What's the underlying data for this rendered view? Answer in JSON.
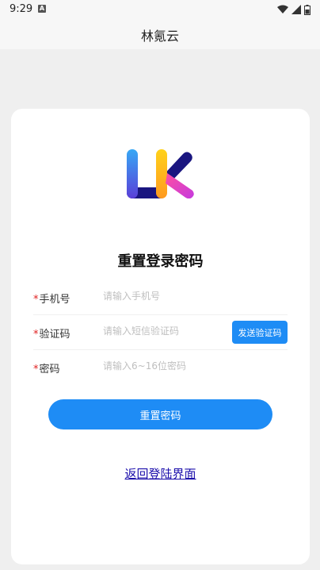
{
  "status_bar": {
    "time": "9:29",
    "notification_icon": "a-icon",
    "wifi_icon": "wifi-icon",
    "signal_icon": "signal-icon",
    "battery_icon": "battery-icon"
  },
  "header": {
    "title": "林氪云"
  },
  "card": {
    "logo_icon": "lk-logo",
    "title": "重置登录密码",
    "fields": {
      "phone": {
        "required_mark": "*",
        "label": "手机号",
        "placeholder": "请输入手机号",
        "value": ""
      },
      "code": {
        "required_mark": "*",
        "label": "验证码",
        "placeholder": "请输入短信验证码",
        "value": ""
      },
      "password": {
        "required_mark": "*",
        "label": "密码",
        "placeholder": "请输入6~16位密码",
        "value": ""
      }
    },
    "send_code_label": "发送验证码",
    "submit_label": "重置密码",
    "back_link_label": "返回登陆界面"
  },
  "colors": {
    "primary": "#1e8cf5",
    "required": "#e02020",
    "link": "#1a0dab",
    "background": "#efefef"
  }
}
